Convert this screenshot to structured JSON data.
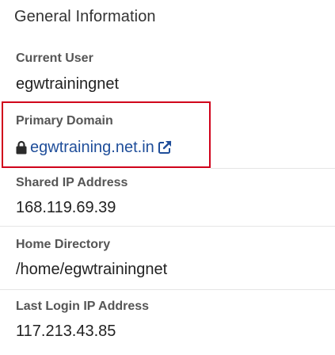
{
  "panel": {
    "title": "General Information"
  },
  "items": {
    "current_user": {
      "label": "Current User",
      "value": "egwtrainingnet"
    },
    "primary_domain": {
      "label": "Primary Domain",
      "value": "egwtraining.net.in",
      "lock_icon": "lock-icon",
      "link_icon": "external-link-icon"
    },
    "shared_ip": {
      "label": "Shared IP Address",
      "value": "168.119.69.39"
    },
    "home_directory": {
      "label": "Home Directory",
      "value": "/home/egwtrainingnet"
    },
    "last_login_ip": {
      "label": "Last Login IP Address",
      "value": "117.213.43.85"
    }
  },
  "colors": {
    "highlight_border": "#d0021b",
    "link": "#1f4e9a"
  }
}
